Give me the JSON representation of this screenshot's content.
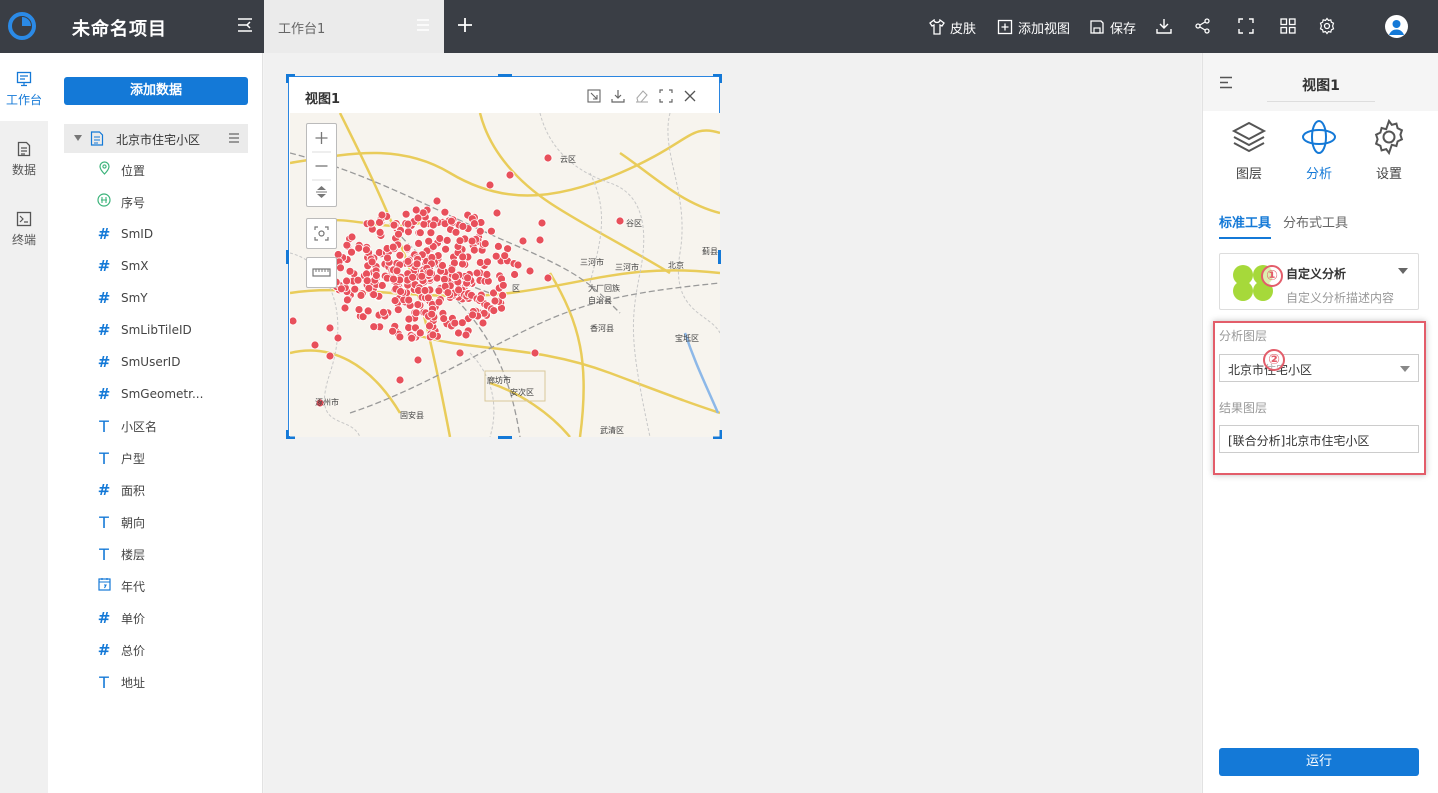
{
  "app": {
    "title": "未命名项目"
  },
  "tabs": [
    {
      "label": "工作台1"
    }
  ],
  "toolbar": {
    "skin_label": "皮肤",
    "add_view_label": "添加视图",
    "save_label": "保存"
  },
  "leftnav": {
    "items": [
      {
        "label": "工作台",
        "icon": "workbench-icon"
      },
      {
        "label": "数据",
        "icon": "data-icon"
      },
      {
        "label": "终端",
        "icon": "terminal-icon"
      }
    ]
  },
  "datapanel": {
    "add_button": "添加数据",
    "dataset": "北京市住宅小区",
    "fields": [
      {
        "name": "位置",
        "type": "location"
      },
      {
        "name": "序号",
        "type": "id"
      },
      {
        "name": "SmID",
        "type": "number"
      },
      {
        "name": "SmX",
        "type": "number"
      },
      {
        "name": "SmY",
        "type": "number"
      },
      {
        "name": "SmLibTileID",
        "type": "number"
      },
      {
        "name": "SmUserID",
        "type": "number"
      },
      {
        "name": "SmGeometr...",
        "type": "number"
      },
      {
        "name": "小区名",
        "type": "text"
      },
      {
        "name": "户型",
        "type": "text"
      },
      {
        "name": "面积",
        "type": "number"
      },
      {
        "name": "朝向",
        "type": "text"
      },
      {
        "name": "楼层",
        "type": "text"
      },
      {
        "name": "年代",
        "type": "date"
      },
      {
        "name": "单价",
        "type": "number"
      },
      {
        "name": "总价",
        "type": "number"
      },
      {
        "name": "地址",
        "type": "text"
      }
    ]
  },
  "view": {
    "title": "视图1",
    "map_labels": [
      "云区",
      "谷区",
      "三河市",
      "三河市",
      "大厂回族",
      "自治县",
      "香河县",
      "宝坻区",
      "蓟县",
      "北京",
      "廊坊市",
      "安次区",
      "涿州市",
      "固安县",
      "武清区",
      "区"
    ]
  },
  "rightpanel": {
    "title": "视图1",
    "tabs": [
      {
        "label": "图层",
        "icon": "layers-icon"
      },
      {
        "label": "分析",
        "icon": "analysis-icon"
      },
      {
        "label": "设置",
        "icon": "settings-icon"
      }
    ],
    "subtabs": {
      "standard": "标准工具",
      "distributed": "分布式工具"
    },
    "analysis": {
      "title": "自定义分析",
      "description": "自定义分析描述内容"
    },
    "badges": [
      "①",
      "②"
    ],
    "analysis_layer_label": "分析图层",
    "analysis_layer_value": "北京市住宅小区",
    "result_layer_label": "结果图层",
    "result_layer_value": "[联合分析]北京市住宅小区",
    "run_label": "运行"
  },
  "colors": {
    "accent": "#1479d7",
    "topbar": "#3a3e45",
    "marker": "#e8505b",
    "highlight": "#e35d6a"
  }
}
